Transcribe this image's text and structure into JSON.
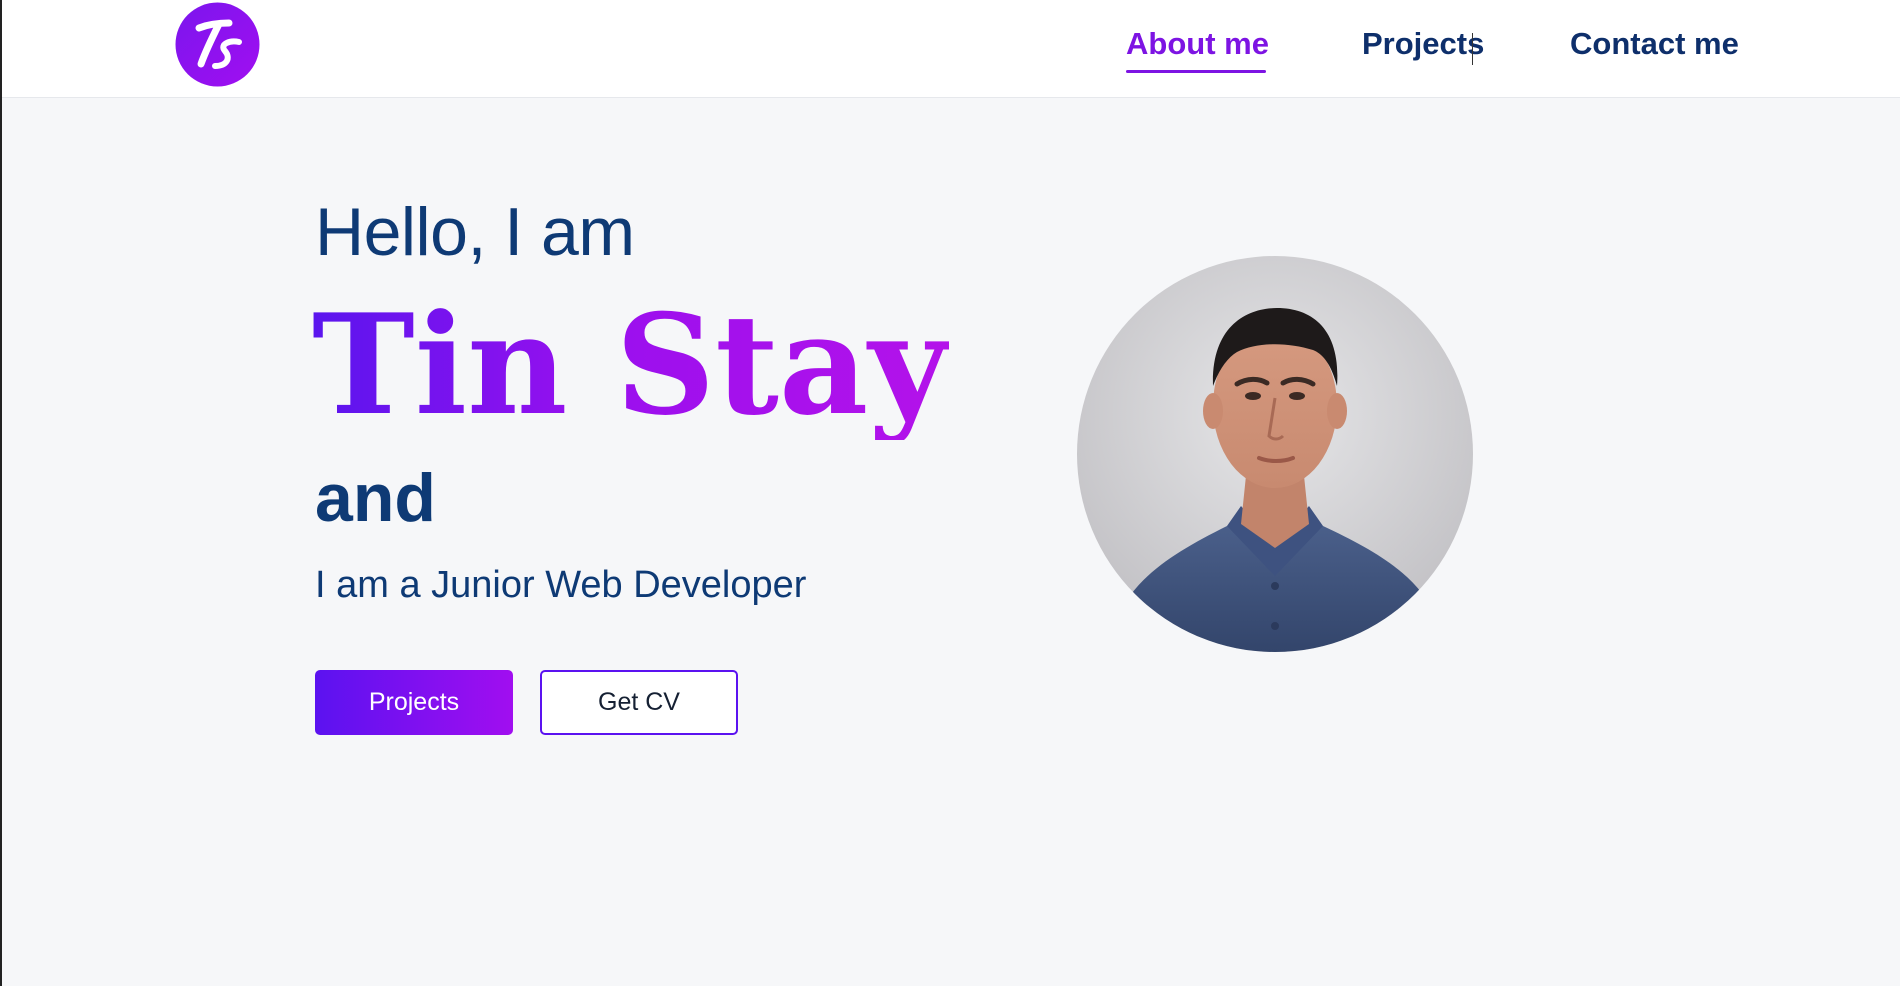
{
  "header": {
    "logo_text": "Ts",
    "nav": [
      {
        "label": "About me",
        "active": true
      },
      {
        "label": "Projects",
        "active": false
      },
      {
        "label": "Contact me",
        "active": false
      }
    ]
  },
  "hero": {
    "greeting": "Hello, I am",
    "name": "Tin Stay",
    "connector": "and",
    "role": "I am a Junior Web Developer",
    "buttons": {
      "primary": "Projects",
      "secondary": "Get CV"
    }
  },
  "colors": {
    "accent": "#7d14e3",
    "gradient_start": "#5b12f0",
    "gradient_end": "#b412ea",
    "text_primary": "#0e3a75",
    "background": "#f6f7f9"
  },
  "icons": {
    "logo": "ts-monogram-logo",
    "portrait": "profile-photo"
  }
}
